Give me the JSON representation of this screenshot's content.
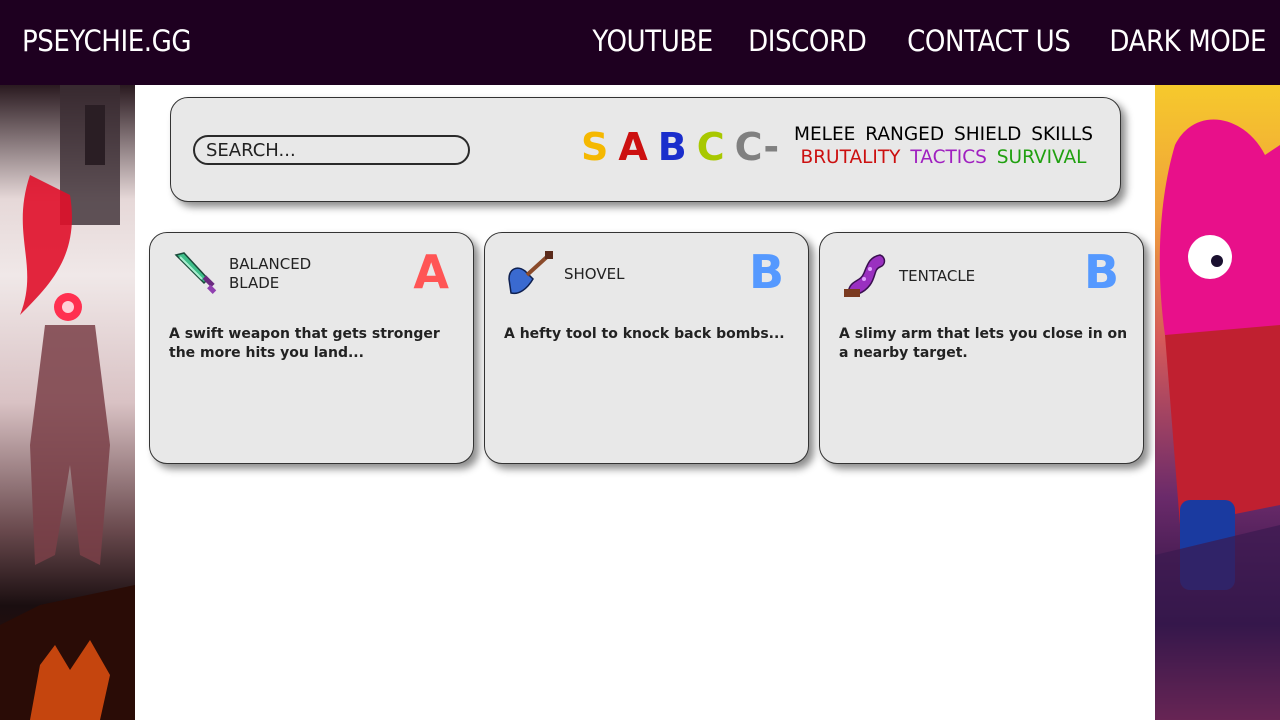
{
  "header": {
    "brand": "PSEYCHIE.GG",
    "nav": [
      "YOUTUBE",
      "DISCORD",
      "CONTACT US",
      "DARK MODE"
    ]
  },
  "filters": {
    "search_placeholder": "SEARCH...",
    "tiers": [
      {
        "label": "S",
        "color": "#f5b800"
      },
      {
        "label": "A",
        "color": "#cc1010"
      },
      {
        "label": "B",
        "color": "#1a2ecc"
      },
      {
        "label": "C",
        "color": "#a8c800"
      },
      {
        "label": "C-",
        "color": "#808080"
      }
    ],
    "weapon_types": [
      "MELEE",
      "RANGED",
      "SHIELD",
      "SKILLS"
    ],
    "stats": [
      {
        "label": "BRUTALITY",
        "color": "#cc1010"
      },
      {
        "label": "TACTICS",
        "color": "#a020c0"
      },
      {
        "label": "SURVIVAL",
        "color": "#20a010"
      }
    ]
  },
  "items": [
    {
      "name": "BALANCED BLADE",
      "grade": "A",
      "grade_color": "#ff5555",
      "icon": "sword-icon",
      "description": "A swift weapon that gets stronger the more hits you land..."
    },
    {
      "name": "SHOVEL",
      "grade": "B",
      "grade_color": "#5599ff",
      "icon": "shovel-icon",
      "description": "A hefty tool to knock back bombs..."
    },
    {
      "name": "TENTACLE",
      "grade": "B",
      "grade_color": "#5599ff",
      "icon": "tentacle-icon",
      "description": "A slimy arm that lets you close in on a nearby target."
    }
  ]
}
